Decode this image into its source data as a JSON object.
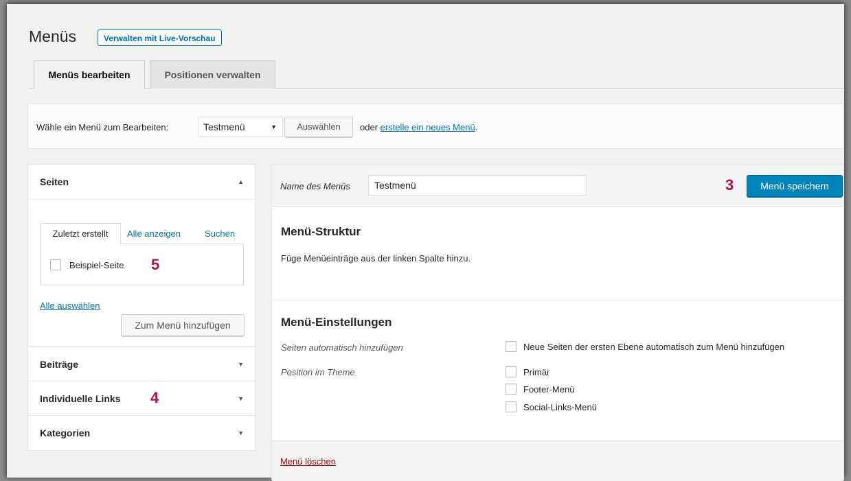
{
  "header": {
    "title": "Menüs",
    "live_preview_button": "Verwalten mit Live-Vorschau"
  },
  "tabs": [
    {
      "label": "Menüs bearbeiten",
      "active": true
    },
    {
      "label": "Positionen verwalten",
      "active": false
    }
  ],
  "select_bar": {
    "label": "Wähle ein Menü zum Bearbeiten:",
    "selected_menu": "Testmenü",
    "select_button": "Auswählen",
    "or_text": "oder",
    "create_link": "erstelle ein neues Menü",
    "period": "."
  },
  "left": {
    "seiten": {
      "title": "Seiten",
      "subtabs": [
        "Zuletzt erstellt",
        "Alle anzeigen",
        "Suchen"
      ],
      "items": [
        {
          "label": "Beispiel-Seite",
          "checked": false
        }
      ],
      "select_all": "Alle auswählen",
      "add_button": "Zum Menü hinzufügen"
    },
    "sections": [
      "Beiträge",
      "Individuelle Links",
      "Kategorien"
    ]
  },
  "right": {
    "name_label": "Name des Menüs",
    "name_value": "Testmenü",
    "save_button": "Menü speichern",
    "structure_title": "Menü-Struktur",
    "structure_hint": "Füge Menüeinträge aus der linken Spalte hinzu.",
    "settings_title": "Menü-Einstellungen",
    "auto_add_label": "Seiten automatisch hinzufügen",
    "auto_add_option": "Neue Seiten der ersten Ebene automatisch zum Menü hinzufügen",
    "position_label": "Position im Theme",
    "positions": [
      "Primär",
      "Footer-Menü",
      "Social-Links-Menü"
    ],
    "delete_link": "Menü löschen"
  },
  "annotations": {
    "n3": "3",
    "n4": "4",
    "n5": "5"
  },
  "colors": {
    "accent": "#0073aa",
    "primary_button": "#0085ba",
    "annotation": "#b0114a",
    "delete": "#a00"
  }
}
